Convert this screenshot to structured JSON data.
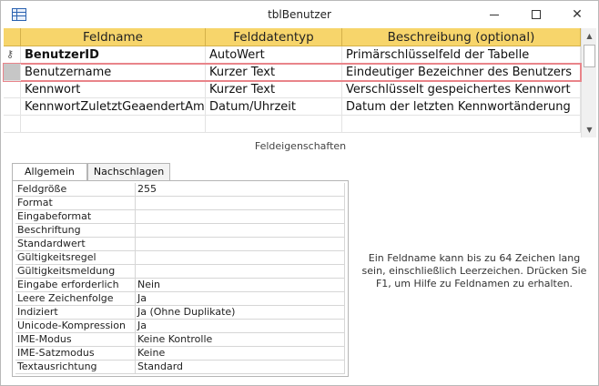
{
  "window": {
    "title": "tblBenutzer"
  },
  "titlebar_buttons": {
    "minimize": "—",
    "maximize": "☐",
    "close": "✕"
  },
  "grid": {
    "headers": [
      "Feldname",
      "Felddatentyp",
      "Beschreibung (optional)"
    ],
    "rows": [
      {
        "name": "BenutzerID",
        "type": "AutoWert",
        "desc": "Primärschlüsselfeld der Tabelle",
        "primary_key": true
      },
      {
        "name": "Benutzername",
        "type": "Kurzer Text",
        "desc": "Eindeutiger Bezeichner des Benutzers",
        "selected": true
      },
      {
        "name": "Kennwort",
        "type": "Kurzer Text",
        "desc": "Verschlüsselt gespeichertes Kennwort"
      },
      {
        "name": "KennwortZuletztGeaendertAm",
        "type": "Datum/Uhrzeit",
        "desc": "Datum der letzten Kennwortänderung"
      }
    ]
  },
  "section_caption": "Feldeigenschaften",
  "tabs": [
    "Allgemein",
    "Nachschlagen"
  ],
  "properties": [
    {
      "label": "Feldgröße",
      "value": "255"
    },
    {
      "label": "Format",
      "value": ""
    },
    {
      "label": "Eingabeformat",
      "value": ""
    },
    {
      "label": "Beschriftung",
      "value": ""
    },
    {
      "label": "Standardwert",
      "value": ""
    },
    {
      "label": "Gültigkeitsregel",
      "value": ""
    },
    {
      "label": "Gültigkeitsmeldung",
      "value": ""
    },
    {
      "label": "Eingabe erforderlich",
      "value": "Nein"
    },
    {
      "label": "Leere Zeichenfolge",
      "value": "Ja"
    },
    {
      "label": "Indiziert",
      "value": "Ja (Ohne Duplikate)"
    },
    {
      "label": "Unicode-Kompression",
      "value": "Ja"
    },
    {
      "label": "IME-Modus",
      "value": "Keine Kontrolle"
    },
    {
      "label": "IME-Satzmodus",
      "value": "Keine"
    },
    {
      "label": "Textausrichtung",
      "value": "Standard"
    }
  ],
  "help_text": "Ein Feldname kann bis zu 64 Zeichen lang sein, einschließlich Leerzeichen. Drücken Sie F1, um Hilfe zu Feldnamen zu erhalten.",
  "colors": {
    "header": "#f7d56b",
    "selection_outline": "#e9848a"
  }
}
